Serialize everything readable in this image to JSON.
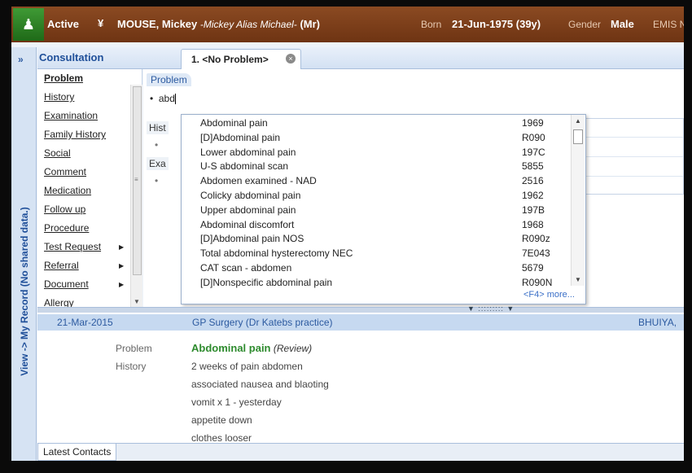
{
  "banner": {
    "status": "Active",
    "chevron": "¥",
    "name": "MOUSE, Mickey",
    "alias": "-Mickey Alias Michael-",
    "title_suffix": "(Mr)",
    "born_label": "Born",
    "born_value": "21-Jun-1975 (39y)",
    "gender_label": "Gender",
    "gender_value": "Male",
    "system_label": "EMIS N"
  },
  "sidebar_strip": {
    "expand": "»",
    "vertical_text": "View -> My Record (No shared data.)"
  },
  "consultation": {
    "title": "Consultation",
    "tab_label": "1. <No Problem>",
    "tab_close": "×"
  },
  "nav": {
    "items": [
      {
        "label": "Problem",
        "selected": true,
        "submenu": false
      },
      {
        "label": "History",
        "selected": false,
        "submenu": false
      },
      {
        "label": "Examination",
        "selected": false,
        "submenu": false
      },
      {
        "label": "Family History",
        "selected": false,
        "submenu": false
      },
      {
        "label": "Social",
        "selected": false,
        "submenu": false
      },
      {
        "label": "Comment",
        "selected": false,
        "submenu": false
      },
      {
        "label": "Medication",
        "selected": false,
        "submenu": false
      },
      {
        "label": "Follow up",
        "selected": false,
        "submenu": false
      },
      {
        "label": "Procedure",
        "selected": false,
        "submenu": false
      },
      {
        "label": "Test Request",
        "selected": false,
        "submenu": true
      },
      {
        "label": "Referral",
        "selected": false,
        "submenu": true
      },
      {
        "label": "Document",
        "selected": false,
        "submenu": true
      },
      {
        "label": "Allergy",
        "selected": false,
        "submenu": false
      }
    ]
  },
  "editor": {
    "section_label": "Problem",
    "input_value": "abd",
    "stub_history": "Hist",
    "stub_exam": "Exa"
  },
  "dropdown": {
    "items": [
      {
        "term": "Abdominal pain",
        "code": "1969"
      },
      {
        "term": "[D]Abdominal pain",
        "code": "R090"
      },
      {
        "term": "Lower abdominal pain",
        "code": "197C"
      },
      {
        "term": "U-S abdominal scan",
        "code": "5855"
      },
      {
        "term": "Abdomen examined - NAD",
        "code": "2516"
      },
      {
        "term": "Colicky abdominal pain",
        "code": "1962"
      },
      {
        "term": "Upper abdominal pain",
        "code": "197B"
      },
      {
        "term": "Abdominal discomfort",
        "code": "1968"
      },
      {
        "term": "[D]Abdominal pain NOS",
        "code": "R090z"
      },
      {
        "term": "Total abdominal hysterectomy NEC",
        "code": "7E043"
      },
      {
        "term": "CAT scan - abdomen",
        "code": "5679"
      },
      {
        "term": "[D]Nonspecific abdominal pain",
        "code": "R090N"
      }
    ],
    "more_link": "<F4> more..."
  },
  "record": {
    "date": "21-Mar-2015",
    "location": "GP Surgery (Dr Katebs practice)",
    "user": "BHUIYA,",
    "problem_label": "Problem",
    "problem_value": "Abdominal pain",
    "problem_note": "(Review)",
    "history_label": "History",
    "history_lines": [
      "2 weeks of pain abdomen",
      "associated nausea and blaoting",
      "vomit x 1 - yesterday",
      "appetite down",
      "clothes looser"
    ]
  },
  "bottom": {
    "tab_label": "Latest Contacts"
  },
  "colors": {
    "banner": "#7a3c18",
    "logo": "#2f8a2a",
    "accent": "#2c5aa0",
    "problem_green": "#2e8b2e",
    "record_header": "#c6d9f0"
  }
}
